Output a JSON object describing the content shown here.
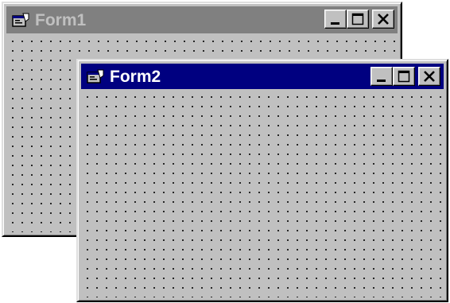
{
  "windows": {
    "form1": {
      "title": "Form1",
      "state": "inactive",
      "icon": "form-icon",
      "buttons": {
        "minimize": "minimize-icon",
        "maximize": "maximize-icon",
        "close": "close-icon"
      }
    },
    "form2": {
      "title": "Form2",
      "state": "active",
      "icon": "form-icon",
      "buttons": {
        "minimize": "minimize-icon",
        "maximize": "maximize-icon",
        "close": "close-icon"
      }
    }
  },
  "colors": {
    "face": "#c0c0c0",
    "active_title": "#000080",
    "inactive_title": "#808080",
    "active_title_text": "#ffffff",
    "inactive_title_text": "#c0c0c0",
    "grid_dot": "#000000"
  }
}
